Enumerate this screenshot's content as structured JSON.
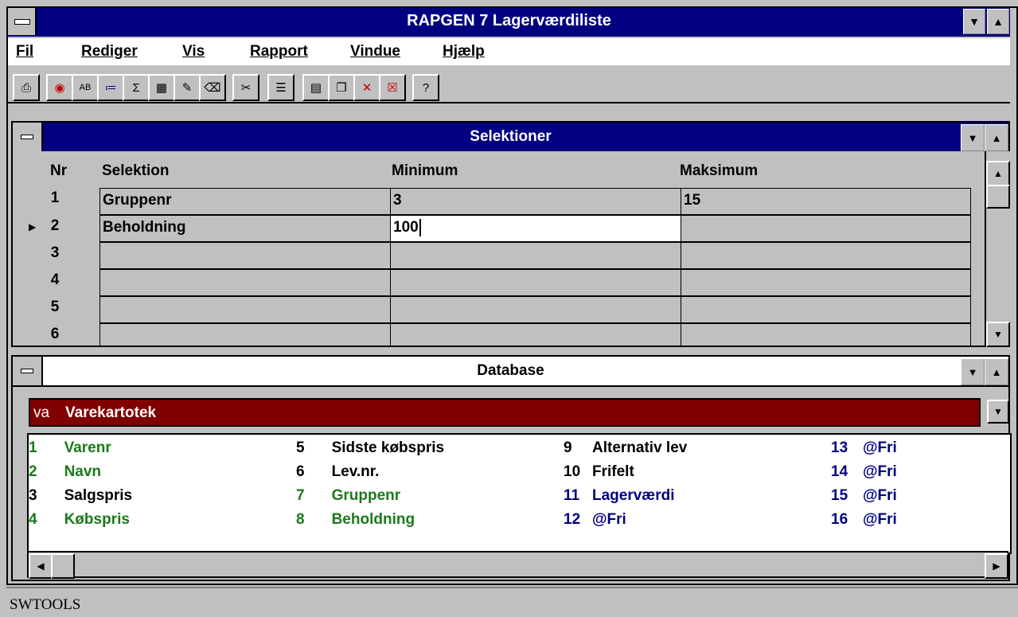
{
  "app": {
    "title": "RAPGEN 7 Lagerværdiliste"
  },
  "menu": {
    "items": [
      {
        "label": "Fil"
      },
      {
        "label": "Rediger"
      },
      {
        "label": "Vis"
      },
      {
        "label": "Rapport"
      },
      {
        "label": "Vindue"
      },
      {
        "label": "Hjælp"
      }
    ]
  },
  "toolbar": {
    "icons": [
      "print-icon",
      "record-icon",
      "ab-field-icon",
      "list-icon",
      "sum-icon",
      "calculator-icon",
      "edit-form-icon",
      "eraser-icon",
      "cut-icon",
      "indent-icon",
      "window-tile-icon",
      "window-cascade-icon",
      "close-window-icon",
      "delete-window-icon",
      "help-icon"
    ],
    "glyphs": [
      "⎙",
      "◉",
      "AB",
      "≔",
      "Σ",
      "▦",
      "✎",
      "⌫",
      "✂",
      "☰",
      "▤",
      "❐",
      "✕",
      "☒",
      "?"
    ]
  },
  "selektioner": {
    "title": "Selektioner",
    "columns": {
      "nr": "Nr",
      "selektion": "Selektion",
      "minimum": "Minimum",
      "maksimum": "Maksimum"
    },
    "rows": [
      {
        "nr": "1",
        "selektion": "Gruppenr",
        "minimum": "3",
        "maksimum": "15"
      },
      {
        "nr": "2",
        "selektion": "Beholdning",
        "minimum": "100",
        "maksimum": ""
      },
      {
        "nr": "3",
        "selektion": "",
        "minimum": "",
        "maksimum": ""
      },
      {
        "nr": "4",
        "selektion": "",
        "minimum": "",
        "maksimum": ""
      },
      {
        "nr": "5",
        "selektion": "",
        "minimum": "",
        "maksimum": ""
      },
      {
        "nr": "6",
        "selektion": "",
        "minimum": "",
        "maksimum": ""
      }
    ],
    "current_row": "2"
  },
  "database": {
    "title": "Database",
    "table_code": "va",
    "table_name": "Varekartotek",
    "fields": [
      {
        "nr": "1",
        "name": "Varenr",
        "color": "#1a7a1a"
      },
      {
        "nr": "2",
        "name": "Navn",
        "color": "#1a7a1a"
      },
      {
        "nr": "3",
        "name": "Salgspris",
        "color": "#000000"
      },
      {
        "nr": "4",
        "name": "Købspris",
        "color": "#1a7a1a"
      },
      {
        "nr": "5",
        "name": "Sidste købspris",
        "color": "#000000"
      },
      {
        "nr": "6",
        "name": "Lev.nr.",
        "color": "#000000"
      },
      {
        "nr": "7",
        "name": "Gruppenr",
        "color": "#1a7a1a"
      },
      {
        "nr": "8",
        "name": "Beholdning",
        "color": "#1a7a1a"
      },
      {
        "nr": "9",
        "name": "Alternativ lev",
        "color": "#000000"
      },
      {
        "nr": "10",
        "name": "Frifelt",
        "color": "#000000"
      },
      {
        "nr": "11",
        "name": "Lagerværdi",
        "color": "#000080"
      },
      {
        "nr": "12",
        "name": "@Fri",
        "color": "#000080"
      },
      {
        "nr": "13",
        "name": "@Fri",
        "color": "#000080"
      },
      {
        "nr": "14",
        "name": "@Fri",
        "color": "#000080"
      },
      {
        "nr": "15",
        "name": "@Fri",
        "color": "#000080"
      },
      {
        "nr": "16",
        "name": "@Fri",
        "color": "#000080"
      }
    ]
  },
  "status": {
    "text": "SWTOOLS"
  },
  "colors": {
    "titlebar": "#000080",
    "selected_table": "#800000",
    "window_bg": "#c0c0c0"
  }
}
